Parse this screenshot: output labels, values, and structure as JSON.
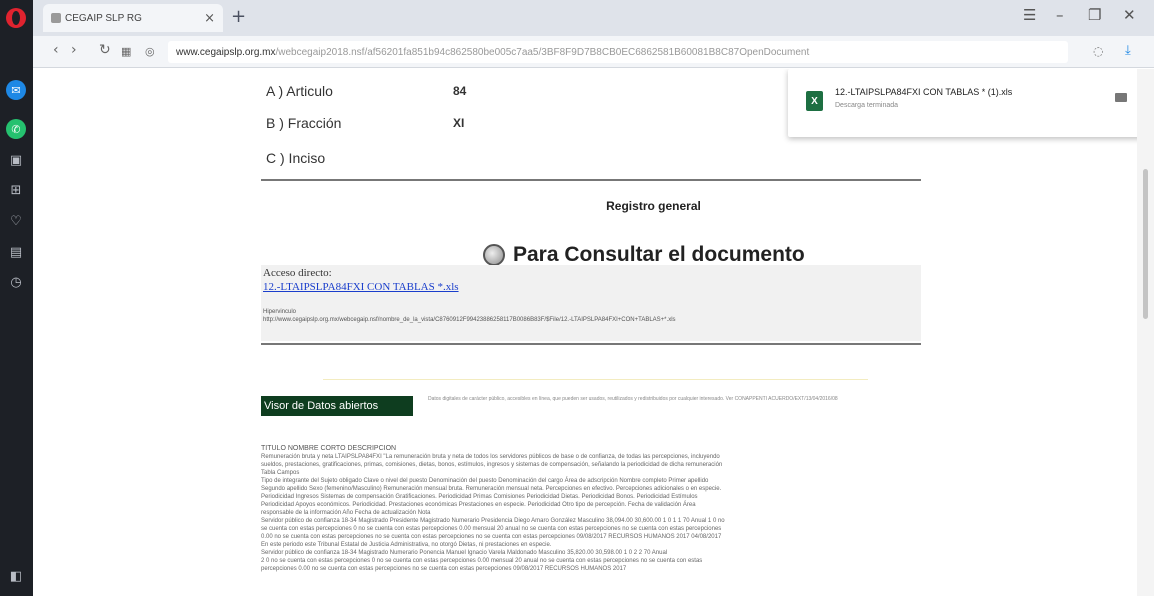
{
  "browser": {
    "tab_title": "CEGAIP SLP RG",
    "new_tab": "+",
    "close": "×",
    "url_host": "www.cegaipslp.org.mx",
    "url_rest": "/webcegaip2018.nsf/af56201fa851b94c862580be005c7aa5/3BF8F9D7B8CB0EC6862581B60081B8C87OpenDocument"
  },
  "page": {
    "fields": [
      {
        "label": "A ) Articulo",
        "value": "84"
      },
      {
        "label": "B ) Fracción",
        "value": "XI"
      },
      {
        "label": "C ) Inciso",
        "value": ""
      }
    ],
    "registro": "Registro general",
    "consult_title": "Para Consultar el documento",
    "access_label": "Acceso directo:",
    "access_link": "12.-LTAIPSLPA84FXI CON TABLAS *.xls",
    "hyper_label": "Hipervinculo",
    "hyper_url": "http://www.cegaipslp.org.mx/webcegaip.nsf/nombre_de_la_vista/C8760912F99423886258117B0086B83F/$File/12.-LTAIPSLPA84FXI+CON+TABLAS+*.xls",
    "visor_button": "Visor de Datos abiertos",
    "visor_desc": "Datos digitales de carácter público, accesibles en línea, que pueden ser usados, reutilizados y redistribuidos por cualquier interesado. Ver CONAPPENTI ACUERDO/EXT/13/04/2016/08",
    "data_heading": "TITULO NOMBRE CORTO DESCRIPCION",
    "data_lines": [
      "Remuneración bruta y neta LTAIPSLPA84FXI \"La remuneración bruta y neta de todos los servidores públicos de base o de confianza, de todas las percepciones, incluyendo",
      "sueldos, prestaciones, gratificaciones, primas, comisiones, dietas, bonos, estímulos, ingresos y sistemas de compensación, señalando la periodicidad de dicha remuneración",
      "Tabla Campos",
      "Tipo de integrante del Sujeto obligado Clave o nivel del puesto Denominación del puesto Denominación del cargo Área de adscripción Nombre completo Primer apellido",
      "Segundo apellido Sexo (femenino/Masculino) Remuneración mensual bruta. Remuneración mensual neta. Percepciones en efectivo. Percepciones adicionales o en especie.",
      "Periodicidad Ingresos Sistemas de compensación Gratificaciones. Periodicidad Primas Comisiones Periodicidad Dietas. Periodicidad Bonos. Periodicidad Estímulos",
      "Periodicidad Apoyos económicos. Periodicidad. Prestaciones económicas Prestaciones en especie. Periodicidad Otro tipo de percepción. Fecha de validación Área",
      "responsable de la información Año Fecha de actualización Nota",
      "Servidor público de confianza 18-34 Magistrado Presidente Magistrado Numerario Presidencia Diego Amaro González Masculino 38,094.00 30,600.00 1 0 1 1 70 Anual 1 0 no",
      "se cuenta con estas percepciones 0 no se cuenta con estas percepciones 0.00 mensual 20 anual no se cuenta con estas percepciones no se cuenta con estas percepciones",
      "0.00 no se cuenta con estas percepciones no se cuenta con estas percepciones no se cuenta con estas percepciones 09/08/2017 RECURSOS HUMANOS 2017 04/08/2017",
      "En este periodo este Tribunal Estatal de Justicia Administrativa, no otorgó Dietas, ni prestaciones en especie.",
      "Servidor público de confianza 18-34 Magistrado Numerario Ponencia Manuel Ignacio Varela Maldonado Masculino 35,820.00 30,598.00 1 0 2 2 70 Anual",
      "2 0 no se cuenta con estas percepciones 0 no se cuenta con estas percepciones 0.00 mensual 20 anual no se cuenta con estas percepciones no se cuenta con estas",
      "percepciones 0.00 no se cuenta con estas percepciones no se cuenta con estas percepciones 09/08/2017 RECURSOS HUMANOS 2017"
    ],
    "download": {
      "file": "12.-LTAIPSLPA84FXI CON TABLAS * (1).xls",
      "status": "Descarga terminada",
      "excel_letter": "X"
    }
  },
  "colors": {
    "sidebar_bg": "#1d2026",
    "opera_red": "#e0232f",
    "visor_green": "#0e3d1f",
    "link_blue": "#1a3ecc"
  }
}
